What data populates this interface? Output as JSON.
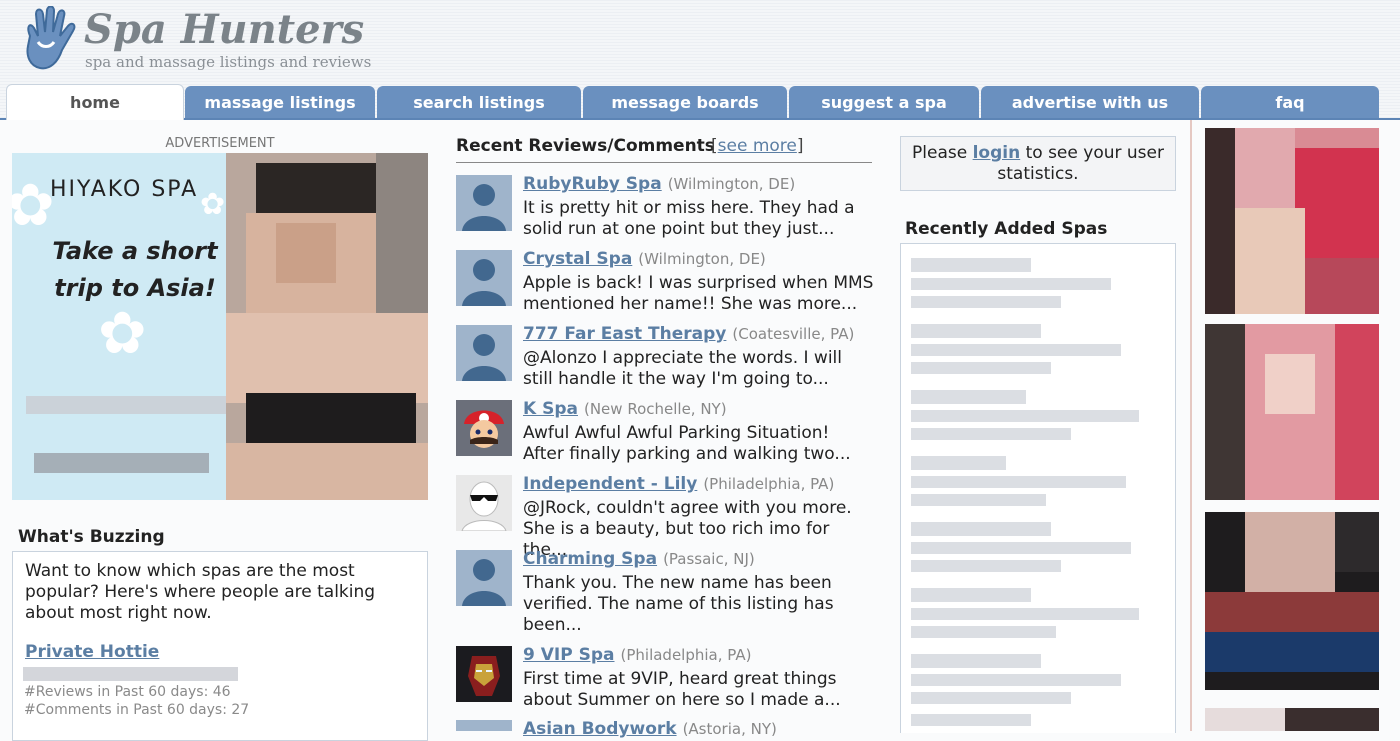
{
  "site": {
    "title": "Spa Hunters",
    "tagline": "spa and massage listings and reviews"
  },
  "nav": {
    "tabs": [
      {
        "label": "home",
        "active": true
      },
      {
        "label": "massage listings"
      },
      {
        "label": "search listings"
      },
      {
        "label": "message boards"
      },
      {
        "label": "suggest a spa"
      },
      {
        "label": "advertise with us"
      },
      {
        "label": "faq"
      }
    ]
  },
  "advertisement": {
    "label": "ADVERTISEMENT",
    "brand": "HIYAKO SPA",
    "copy": "Take a short trip to Asia!"
  },
  "buzzing": {
    "title": "What's Buzzing",
    "intro": "Want to know which spas are the most popular? Here's where people are talking about most right now.",
    "top_spa": "Private Hottie",
    "reviews_stat": "#Reviews in Past 60 days: 46",
    "comments_stat": "#Comments in Past 60 days: 27"
  },
  "reviews": {
    "title": "Recent Reviews/Comments",
    "see_more_open": "[",
    "see_more": "see more",
    "see_more_close": "]",
    "items": [
      {
        "name": "RubyRuby Spa",
        "location": "(Wilmington, DE)",
        "text": "It is pretty hit or miss here. They had a solid run at one point but they just...",
        "avatar": "default-avatar"
      },
      {
        "name": "Crystal Spa",
        "location": "(Wilmington, DE)",
        "text": "Apple is back! I was surprised when MMS mentioned her name!! She was more...",
        "avatar": "default-avatar"
      },
      {
        "name": "777 Far East Therapy",
        "location": "(Coatesville, PA)",
        "text": "@Alonzo I appreciate the words. I will still handle it the way I'm going to...",
        "avatar": "default-avatar"
      },
      {
        "name": "K Spa",
        "location": "(New Rochelle, NY)",
        "text": "Awful Awful Awful Parking Situation! After finally parking and walking two...",
        "avatar": "mario-avatar"
      },
      {
        "name": "Independent - Lily",
        "location": "(Philadelphia, PA)",
        "text": "@JRock, couldn't agree with you more. She is a beauty, but too rich imo for the...",
        "avatar": "sunglasses-avatar"
      },
      {
        "name": "Charming Spa",
        "location": "(Passaic, NJ)",
        "text": "Thank you. The new name has been verified. The name of this listing has been...",
        "avatar": "default-avatar"
      },
      {
        "name": "9 VIP Spa",
        "location": "(Philadelphia, PA)",
        "text": "First time at 9VIP, heard great things about Summer on here so I made a...",
        "avatar": "ironman-avatar"
      },
      {
        "name": "Asian Bodywork",
        "location": "(Astoria, NY)",
        "text": "",
        "avatar": "default-avatar"
      }
    ]
  },
  "login_prompt": {
    "before": "Please ",
    "link": "login",
    "after": " to see your user statistics."
  },
  "recently_added": {
    "title": "Recently Added Spas"
  },
  "colors": {
    "nav_tab": "#6a90bf",
    "link": "#5b7ea3",
    "border": "#c9d3de"
  }
}
